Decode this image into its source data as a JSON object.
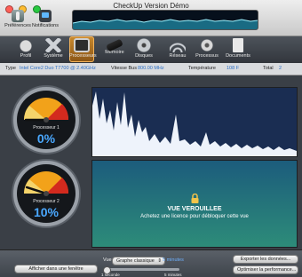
{
  "window": {
    "title": "CheckUp Version Démo"
  },
  "toolbar": {
    "prefs_label": "Préférences",
    "notifications_label": "Notifications"
  },
  "tabs": [
    {
      "label": "Profil",
      "icon": "apple-icon"
    },
    {
      "label": "Système",
      "icon": "system-icon"
    },
    {
      "label": "Processeurs",
      "icon": "processor-icon",
      "active": true
    },
    {
      "label": "Mémoire",
      "icon": "memory-icon"
    },
    {
      "label": "Disques",
      "icon": "disk-icon"
    },
    {
      "label": "Réseau",
      "icon": "network-icon"
    },
    {
      "label": "Processus",
      "icon": "process-icon"
    },
    {
      "label": "Documents",
      "icon": "documents-icon"
    }
  ],
  "info": {
    "type_label": "Type",
    "type_value": "Intel Core2 Duo T7700 @ 2.40GHz",
    "bus_label": "Vitesse Bus",
    "bus_value": "800.00 MHz",
    "temp_label": "Température",
    "temp_value": "108 F",
    "total_label": "Total",
    "total_value": "2"
  },
  "gauges": [
    {
      "label": "Processeur 1",
      "value": "0%",
      "percent": 0
    },
    {
      "label": "Processeur 2",
      "value": "10%",
      "percent": 10
    }
  ],
  "locked": {
    "title": "VUE VEROUILLEE",
    "message": "Achetez une licence pour débloquer cette vue"
  },
  "bottom": {
    "show_window_button": "Afficher dans une fenêtre",
    "view_label": "Vue",
    "view_value": "Graphe classique",
    "interval_top": "5 minutes",
    "slider_min": "1 seconde",
    "slider_max": "5 minutes",
    "export_button": "Exporter les données...",
    "optimize_button": "Optimiser la performance..."
  },
  "colors": {
    "accent": "#4aa8ff",
    "active_tab": "#c98a2e"
  }
}
